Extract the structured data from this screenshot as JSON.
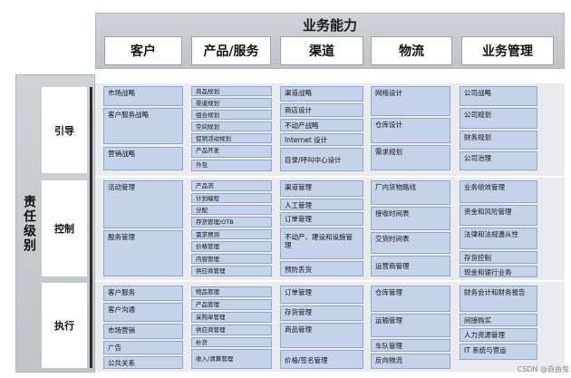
{
  "header": {
    "title": "业务能力"
  },
  "capabilities": [
    "客户",
    "产品/服务",
    "渠道",
    "物流",
    "业务管理"
  ],
  "side_title": "责任级别",
  "levels": [
    "引导",
    "控制",
    "执行"
  ],
  "cells": {
    "c1": [
      "市场战略",
      "客户服务战略",
      "营销战略",
      "活动管理",
      "服务管理",
      "客户服务",
      "客户沟通",
      "市场营销",
      "广告",
      "公共关系"
    ],
    "c2": [
      "商品规划",
      "渠道规划",
      "组合规划",
      "空间规划",
      "促销活动规划",
      "产品开发",
      "外包",
      "产品流",
      "计划编程",
      "分配",
      "存货管理/OTB",
      "需求预测",
      "价格管理",
      "内容管理",
      "供应商管理",
      "物品管理",
      "产品管理",
      "采购单管理",
      "供应商管理",
      "补货",
      "收入/清算管理"
    ],
    "c3": [
      "渠道战略",
      "商店设计",
      "不动产战略",
      "Internet 设计",
      "目录/呼叫中心设计",
      "渠道管理",
      "人工管理",
      "订单管理",
      "不动产、建设和设施管理",
      "预防丢货",
      "订单管理",
      "存货管理",
      "商品管理",
      "价格/签名管理"
    ],
    "c4": [
      "网络设计",
      "仓库设计",
      "需求规划",
      "厂内货物路线",
      "接收时间表",
      "交货时间表",
      "运营商管理",
      "仓库管理",
      "运输管理",
      "车队管理",
      "反向物流"
    ],
    "c5": [
      "公司战略",
      "公司规划",
      "财务规划",
      "公司治理",
      "业务绩效管理",
      "资金和风险管理",
      "法律和法规遵从性",
      "存货控制",
      "现金和银行业务",
      "财务会计和财务报告",
      "间接购买",
      "人力资源管理",
      "IT 系统与营运"
    ]
  },
  "watermark": "CSDN @自由鬼"
}
